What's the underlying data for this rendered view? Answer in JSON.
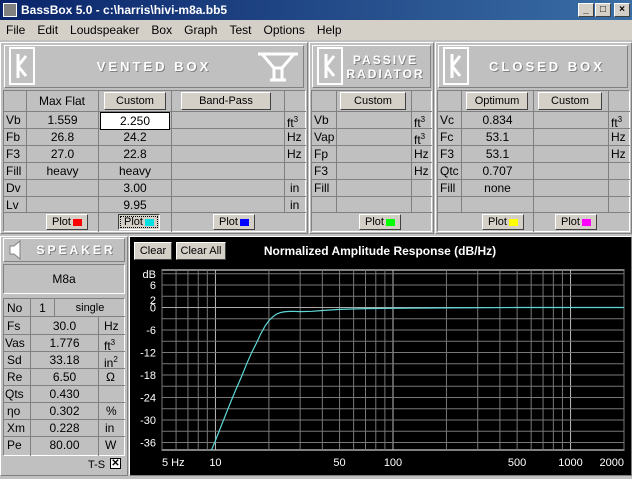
{
  "window": {
    "title": "BassBox 5.0 - c:\\harris\\hivi-m8a.bb5"
  },
  "menu": [
    "File",
    "Edit",
    "Loudspeaker",
    "Box",
    "Graph",
    "Test",
    "Options",
    "Help"
  ],
  "vented": {
    "header": "VENTED BOX",
    "row_labels": [
      "Vb",
      "Fb",
      "F3",
      "Fill",
      "Dv",
      "Lv"
    ],
    "units": [
      "ft3",
      "Hz",
      "Hz",
      "",
      "in",
      "in"
    ],
    "col1": {
      "button": "Max Flat",
      "values": [
        "1.559",
        "26.8",
        "27.0",
        "heavy",
        "",
        ""
      ],
      "plot": "Plot",
      "color": "#ff0000"
    },
    "col2": {
      "button": "Custom",
      "values": [
        "2.250",
        "24.2",
        "22.8",
        "heavy",
        "3.00",
        "9.95"
      ],
      "plot": "Plot",
      "color": "#00e0e0"
    },
    "col3": {
      "button": "Band-Pass",
      "values": [
        "",
        "",
        "",
        "",
        "",
        ""
      ],
      "plot": "Plot",
      "color": "#0000ff"
    }
  },
  "passive": {
    "header_line1": "PASSIVE",
    "header_line2": "RADIATOR",
    "row_labels": [
      "Vb",
      "Vap",
      "Fp",
      "F3",
      "Fill"
    ],
    "units": [
      "ft3",
      "ft3",
      "Hz",
      "Hz",
      ""
    ],
    "button": "Custom",
    "plot": "Plot",
    "color": "#00ff00"
  },
  "closed": {
    "header": "CLOSED BOX",
    "row_labels": [
      "Vc",
      "Fc",
      "F3",
      "Qtc",
      "Fill"
    ],
    "units": [
      "ft3",
      "Hz",
      "Hz",
      "",
      ""
    ],
    "col1": {
      "button": "Optimum",
      "values": [
        "0.834",
        "53.1",
        "53.1",
        "0.707",
        "none"
      ],
      "plot": "Plot",
      "color": "#ffff00"
    },
    "col2": {
      "button": "Custom",
      "plot": "Plot",
      "color": "#ff00ff"
    }
  },
  "speaker": {
    "header": "SPEAKER",
    "model": "M8a",
    "no_label": "No",
    "no_value": "1",
    "config": "single",
    "params": [
      {
        "label": "Fs",
        "value": "30.0",
        "unit": "Hz"
      },
      {
        "label": "Vas",
        "value": "1.776",
        "unit": "ft3"
      },
      {
        "label": "Sd",
        "value": "33.18",
        "unit": "in2"
      },
      {
        "label": "Re",
        "value": "6.50",
        "unit": "Ω"
      },
      {
        "label": "Qts",
        "value": "0.430",
        "unit": ""
      },
      {
        "label": "ηo",
        "value": "0.302",
        "unit": "%"
      },
      {
        "label": "Xm",
        "value": "0.228",
        "unit": "in"
      },
      {
        "label": "Pe",
        "value": "80.00",
        "unit": "W"
      }
    ],
    "ts_label": "T-S",
    "ts_checked": true
  },
  "graph": {
    "clear": "Clear",
    "clear_all": "Clear All",
    "title": "Normalized Amplitude Response (dB/Hz)"
  },
  "chart_data": {
    "type": "line",
    "title": "Normalized Amplitude Response (dB/Hz)",
    "xscale": "log",
    "xlim": [
      5,
      2000
    ],
    "ylim": [
      -38,
      10
    ],
    "xticks": [
      "5 Hz",
      "10",
      "50",
      "100",
      "500",
      "1000",
      "2000"
    ],
    "yticks": [
      "dB",
      "6",
      "2",
      "0",
      "-6",
      "-12",
      "-18",
      "-24",
      "-30",
      "-36"
    ],
    "series": [
      {
        "color": "#5fd7d7",
        "x": [
          9.5,
          10,
          11,
          12,
          13,
          14,
          15,
          16,
          17,
          18,
          19,
          20,
          21,
          22,
          23,
          24,
          25,
          27,
          30,
          35,
          40,
          50,
          70,
          100,
          200,
          500,
          1000,
          2000
        ],
        "y": [
          -38,
          -35.5,
          -30.5,
          -26,
          -22,
          -18.5,
          -15,
          -12,
          -9.5,
          -7,
          -5,
          -3.5,
          -2.5,
          -1.8,
          -1.4,
          -1.2,
          -1.1,
          -1.0,
          -1.1,
          -1.0,
          -0.8,
          -0.5,
          -0.3,
          -0.2,
          -0.1,
          0,
          0,
          0
        ]
      }
    ],
    "grid": true,
    "background": "#000000"
  }
}
